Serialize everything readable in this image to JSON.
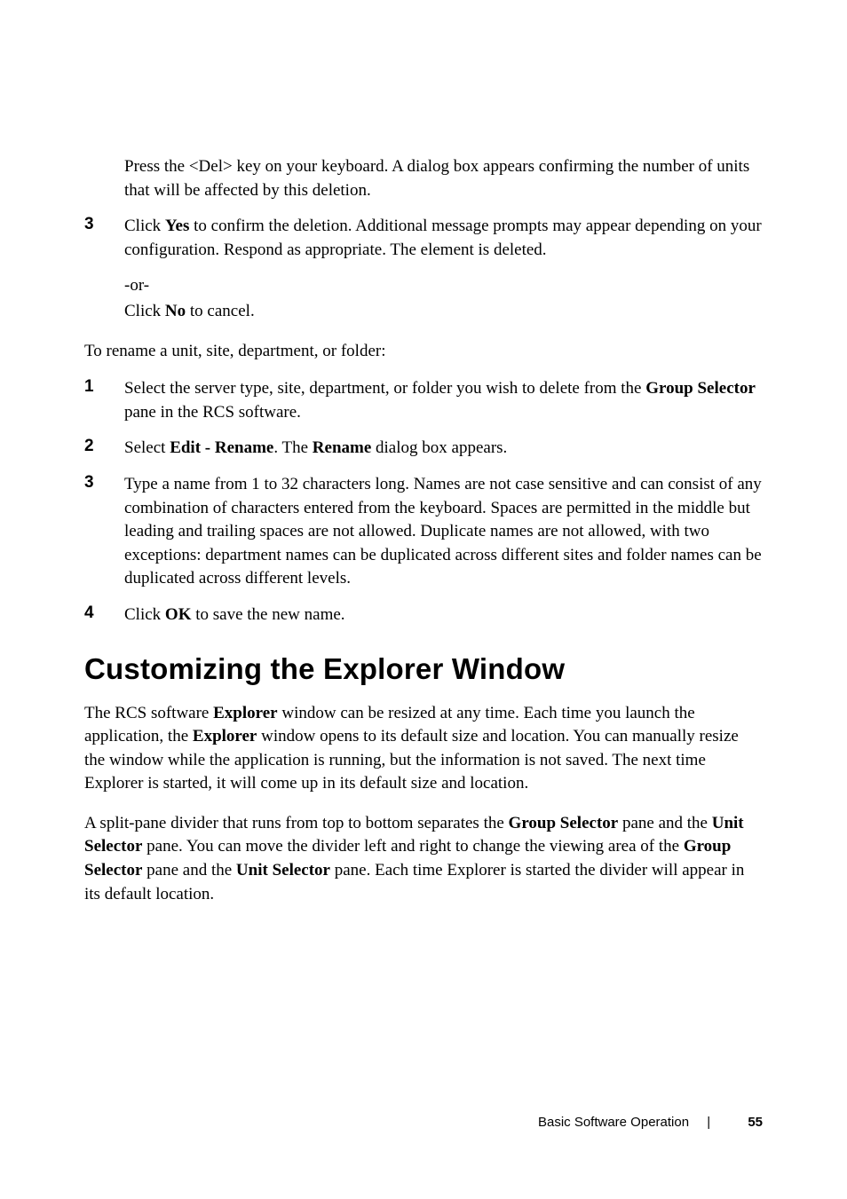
{
  "step2_indent": "Press the <Del> key on your keyboard. A dialog box appears confirming the number of units that will be affected by this deletion.",
  "step3": {
    "num": "3",
    "pre": "Click ",
    "b1": "Yes",
    "mid": " to confirm the deletion. Additional message prompts may appear depending on your configuration. Respond as appropriate. The element is deleted."
  },
  "or1": "-or-",
  "or1_after_pre": "Click ",
  "or1_after_b": "No",
  "or1_after_post": " to cancel.",
  "rename_intro": "To rename a unit, site, department, or folder:",
  "r1": {
    "num": "1",
    "pre": "Select the server type, site, department, or folder you wish to delete from the ",
    "b": "Group Selector",
    "post": " pane in the RCS software."
  },
  "r2": {
    "num": "2",
    "pre": "Select ",
    "b1": "Edit - Rename",
    "mid": ". The ",
    "b2": "Rename",
    "post": " dialog box appears."
  },
  "r3": {
    "num": "3",
    "text": "Type a name from 1 to 32 characters long. Names are not case sensitive and can consist of any combination of characters entered from the keyboard. Spaces are permitted in the middle but leading and trailing spaces are not allowed. Duplicate names are not allowed, with two exceptions: department names can be duplicated across different sites and folder names can be duplicated across different levels."
  },
  "r4": {
    "num": "4",
    "pre": "Click ",
    "b": "OK",
    "post": " to save the new name."
  },
  "h1": "Customizing the Explorer Window",
  "p1": {
    "pre": "The RCS software ",
    "b1": "Explorer",
    "mid1": " window can be resized at any time. Each time you launch the application, the ",
    "b2": "Explorer",
    "post": " window opens to its default size and location. You can manually resize the window while the application is running, but the information is not saved. The next time Explorer is started, it will come up in its default size and location."
  },
  "p2": {
    "pre": "A split-pane divider that runs from top to bottom separates the ",
    "b1": "Group Selector",
    "mid1": " pane and the ",
    "b2": "Unit Selector",
    "mid2": " pane. You can move the divider left and right to change the viewing area of the ",
    "b3": "Group Selector",
    "mid3": " pane and the ",
    "b4": "Unit Selector",
    "post": " pane. Each time Explorer is started the divider will appear in its default location."
  },
  "footer": {
    "section": "Basic Software Operation",
    "sep": "|",
    "page": "55"
  }
}
